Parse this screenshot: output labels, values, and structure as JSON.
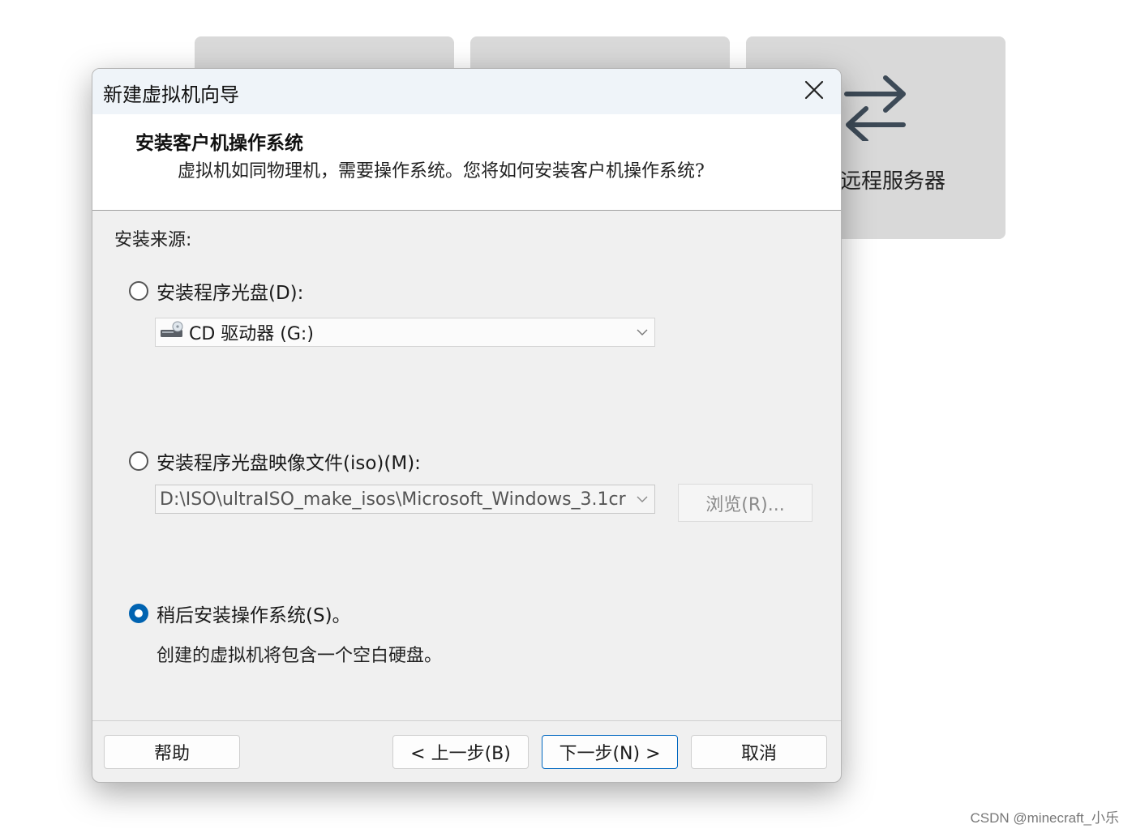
{
  "background": {
    "card3_label": "连远程服务器",
    "card3_icon": "swap-arrows-icon"
  },
  "dialog": {
    "title": "新建虚拟机向导",
    "close_icon": "close-icon",
    "header_title": "安装客户机操作系统",
    "header_subtitle": "虚拟机如同物理机，需要操作系统。您将如何安装客户机操作系统?",
    "source_label": "安装来源:",
    "options": {
      "disc": {
        "label": "安装程序光盘(D):",
        "selected": false,
        "drive_value": "CD 驱动器 (G:)",
        "drive_icon": "optical-drive-icon"
      },
      "iso": {
        "label": "安装程序光盘映像文件(iso)(M):",
        "selected": false,
        "path_value": "D:\\ISO\\ultraISO_make_isos\\Microsoft_Windows_3.1cr",
        "browse_label": "浏览(R)..."
      },
      "later": {
        "label": "稍后安装操作系统(S)。",
        "selected": true,
        "description": "创建的虚拟机将包含一个空白硬盘。"
      }
    },
    "buttons": {
      "help": "帮助",
      "back": "< 上一步(B)",
      "next": "下一步(N) >",
      "cancel": "取消"
    }
  },
  "watermark": "CSDN @minecraft_小乐",
  "colors": {
    "accent": "#0063b1",
    "dialog_bg": "#f0f0f0",
    "titlebar_bg": "#eff4f9"
  }
}
